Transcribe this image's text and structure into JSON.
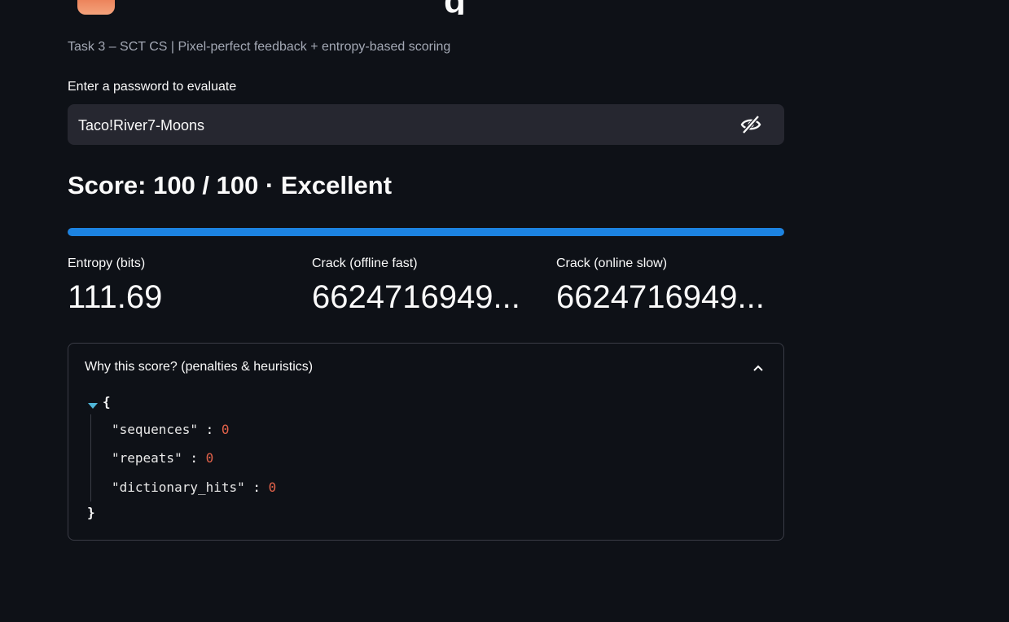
{
  "header": {
    "title_icon": "orange-icon",
    "title_fragment": "g",
    "caption": "Task 3 – SCT CS | Pixel-perfect feedback + entropy-based scoring"
  },
  "password_input": {
    "label": "Enter a password to evaluate",
    "value": "Taco!River7-Moons",
    "toggle_icon": "eye-off-icon"
  },
  "score": {
    "heading": "Score: 100 / 100 · Excellent",
    "value": 100,
    "max": 100,
    "progress_fraction": 1.0,
    "progress_color": "#1c83e1"
  },
  "metrics": [
    {
      "label": "Entropy (bits)",
      "value": "111.69"
    },
    {
      "label": "Crack (offline fast)",
      "value": "6624716949..."
    },
    {
      "label": "Crack (online slow)",
      "value": "6624716949..."
    }
  ],
  "expander": {
    "title": "Why this score? (penalties & heuristics)",
    "expanded": true,
    "json": {
      "open_brace": "{",
      "close_brace": "}",
      "rows": [
        {
          "key": "\"sequences\"",
          "value": "0"
        },
        {
          "key": "\"repeats\"",
          "value": "0"
        },
        {
          "key": "\"dictionary_hits\"",
          "value": "0"
        }
      ]
    }
  },
  "colors": {
    "background": "#0e1117",
    "input_background": "#262730",
    "accent": "#1c83e1",
    "json_number": "#e2624a",
    "json_caret": "#4fb6d8"
  }
}
